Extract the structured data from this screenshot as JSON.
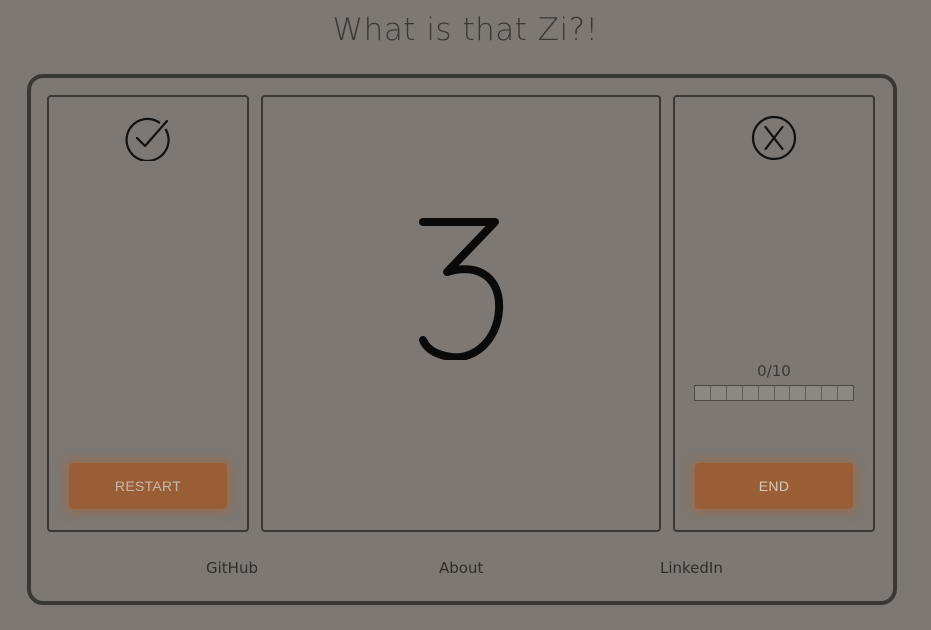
{
  "header": {
    "title": "What is that Zi?!"
  },
  "left_panel": {
    "icon": "check-circle-icon",
    "restart_label": "RESTART"
  },
  "center_panel": {
    "character": "3"
  },
  "right_panel": {
    "icon": "x-circle-icon",
    "progress_text": "0/10",
    "progress": {
      "current": 0,
      "total": 10
    },
    "end_label": "END"
  },
  "footer": {
    "links": [
      {
        "label": "GitHub"
      },
      {
        "label": "About"
      },
      {
        "label": "LinkedIn"
      }
    ]
  },
  "colors": {
    "background": "#7d7873",
    "border": "#3a3835",
    "button": "#9a5e36",
    "button_glow": "#b0622c"
  }
}
